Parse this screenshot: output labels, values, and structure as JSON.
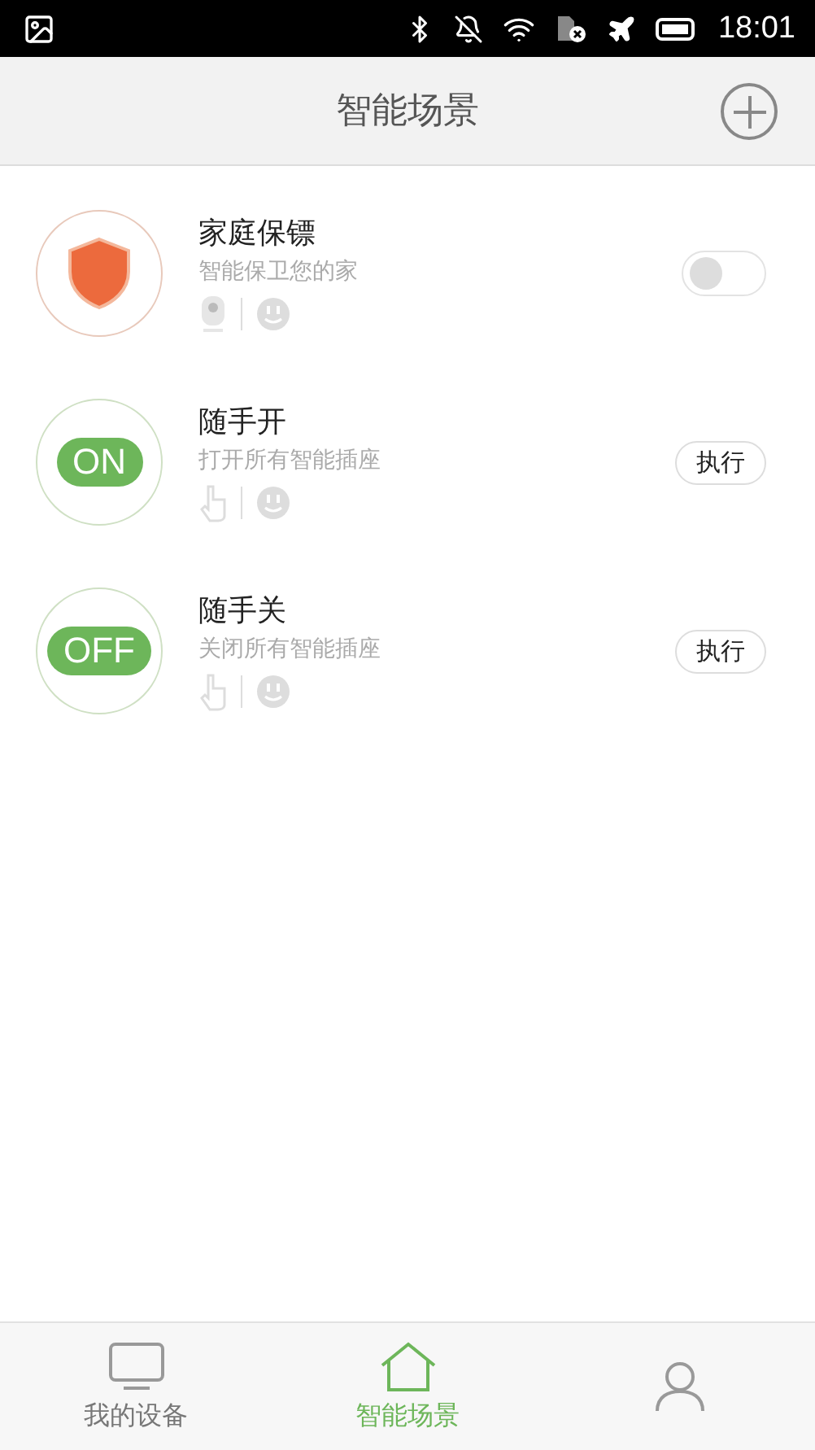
{
  "status_bar": {
    "time": "18:01"
  },
  "header": {
    "title": "智能场景"
  },
  "scenes": [
    {
      "kind": "guard",
      "title": "家庭保镖",
      "subtitle": "智能保卫您的家",
      "on": false
    },
    {
      "kind": "execute",
      "badge": "ON",
      "title": "随手开",
      "subtitle": "打开所有智能插座",
      "button": "执行"
    },
    {
      "kind": "execute",
      "badge": "OFF",
      "title": "随手关",
      "subtitle": "关闭所有智能插座",
      "button": "执行"
    }
  ],
  "tabs": [
    {
      "label": "我的设备",
      "selected": false
    },
    {
      "label": "智能场景",
      "selected": true
    },
    {
      "selected": false
    }
  ]
}
